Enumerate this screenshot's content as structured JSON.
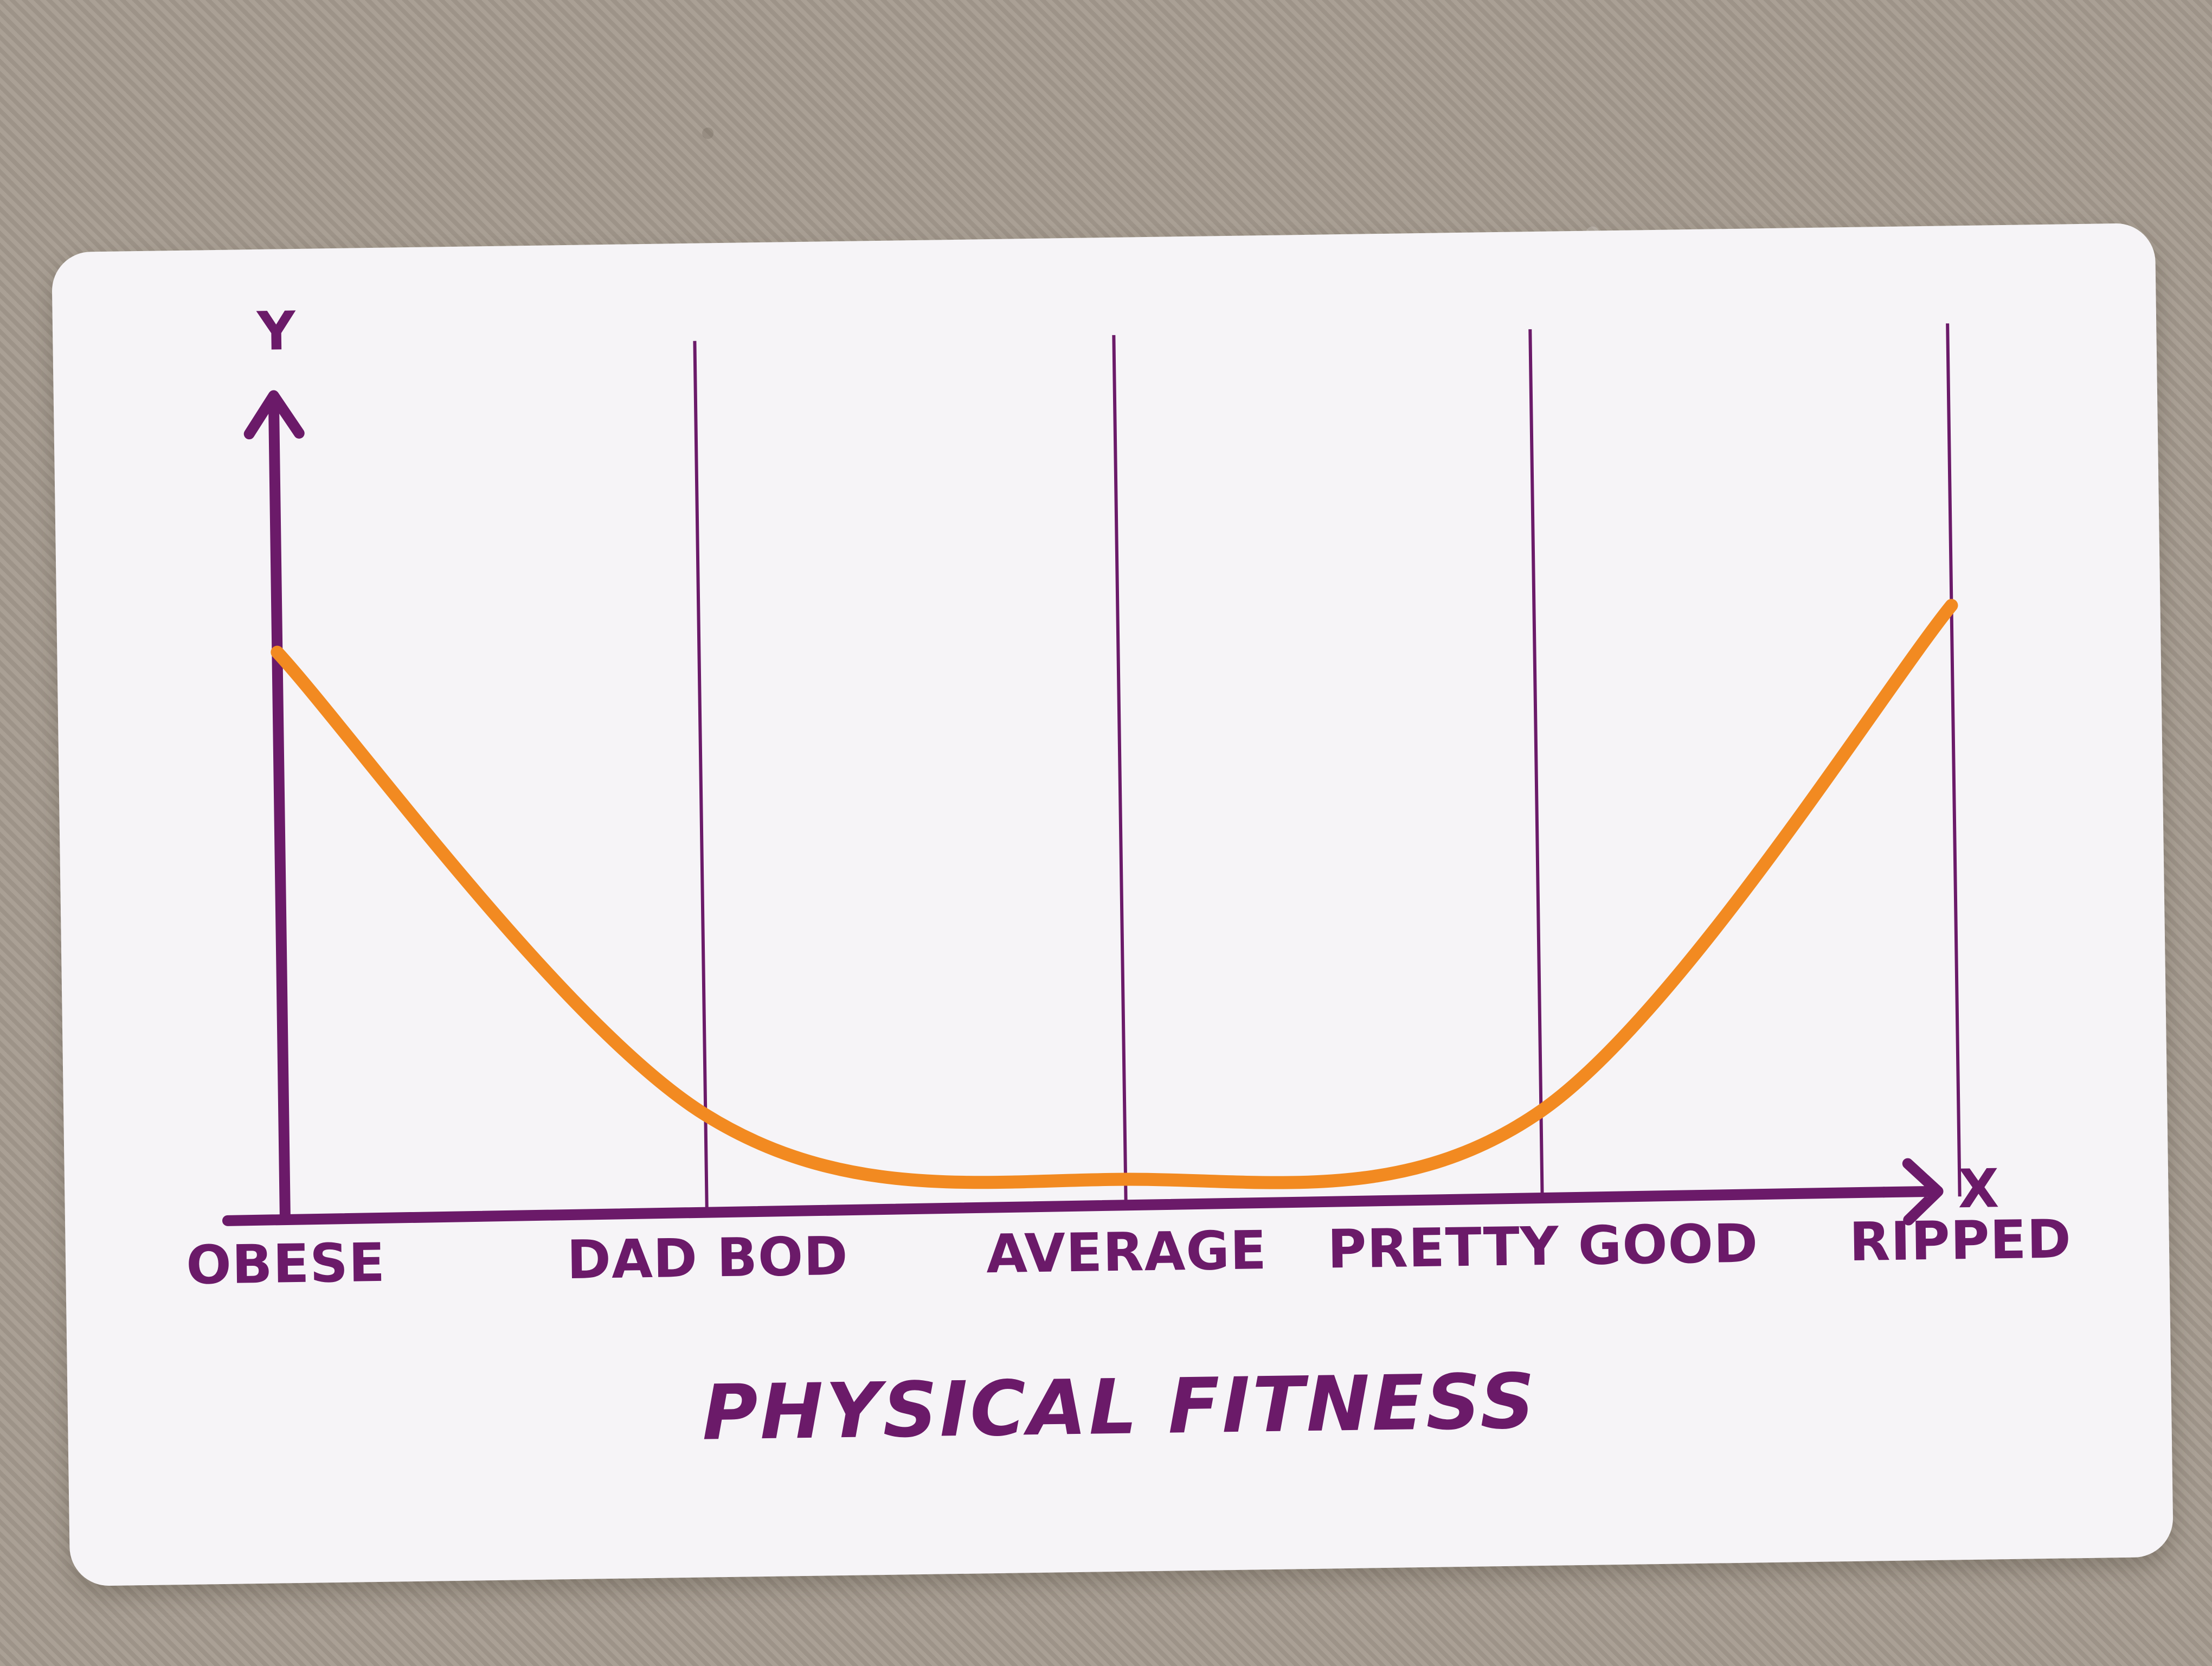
{
  "chart_data": {
    "type": "line",
    "categories": [
      "OBESE",
      "DAD BOD",
      "AVERAGE",
      "PRETTY GOOD",
      "RIPPED"
    ],
    "x": [
      0,
      1,
      2,
      3,
      4
    ],
    "series": [
      {
        "values": [
          0.72,
          0.12,
          0.03,
          0.11,
          0.75
        ]
      }
    ],
    "axis_letters": {
      "x": "X",
      "y": "Y"
    },
    "xlabel": "PHYSICAL FITNESS",
    "ylabel": "",
    "grid": true,
    "colors": {
      "curve": "#f28a21",
      "axes": "#6b1a69"
    }
  }
}
